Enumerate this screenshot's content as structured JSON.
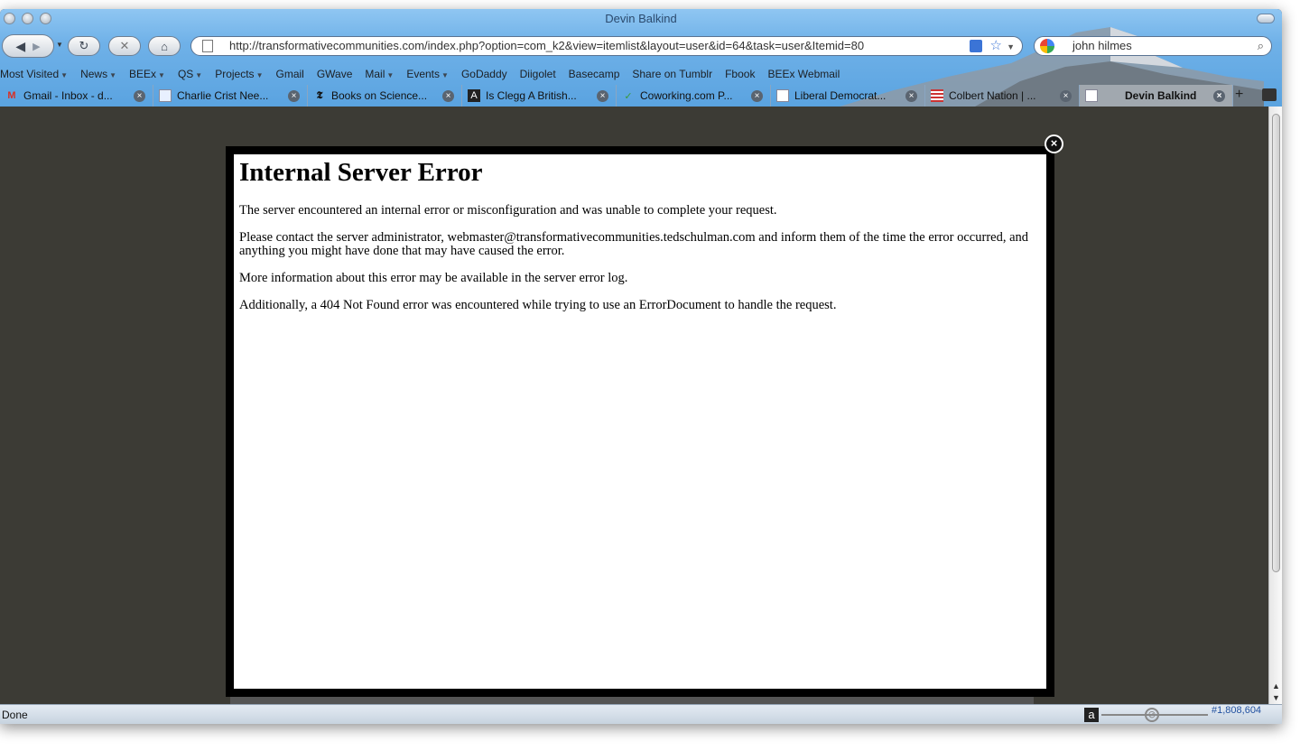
{
  "window": {
    "title": "Devin Balkind"
  },
  "nav": {
    "url": "http://transformativecommunities.com/index.php?option=com_k2&view=itemlist&layout=user&id=64&task=user&Itemid=80",
    "search_value": "john hilmes"
  },
  "bookmarks": [
    {
      "label": "Most Visited",
      "dropdown": true
    },
    {
      "label": "News",
      "dropdown": true
    },
    {
      "label": "BEEx",
      "dropdown": true
    },
    {
      "label": "QS",
      "dropdown": true
    },
    {
      "label": "Projects",
      "dropdown": true
    },
    {
      "label": "Gmail",
      "dropdown": false
    },
    {
      "label": "GWave",
      "dropdown": false
    },
    {
      "label": "Mail",
      "dropdown": true
    },
    {
      "label": "Events",
      "dropdown": true
    },
    {
      "label": "GoDaddy",
      "dropdown": false
    },
    {
      "label": "Diigolet",
      "dropdown": false
    },
    {
      "label": "Basecamp",
      "dropdown": false
    },
    {
      "label": "Share on Tumblr",
      "dropdown": false
    },
    {
      "label": "Fbook",
      "dropdown": false
    },
    {
      "label": "BEEx Webmail",
      "dropdown": false
    }
  ],
  "tabs": [
    {
      "label": "Gmail - Inbox - d...",
      "icon": "gmail-icon"
    },
    {
      "label": "Charlie Crist Nee...",
      "icon": "page-icon"
    },
    {
      "label": "Books on Science...",
      "icon": "nytimes-icon"
    },
    {
      "label": "Is Clegg A British...",
      "icon": "atlantic-icon"
    },
    {
      "label": "Coworking.com P...",
      "icon": "coworking-icon"
    },
    {
      "label": "Liberal Democrat...",
      "icon": "page-icon"
    },
    {
      "label": "Colbert Nation | ...",
      "icon": "flag-icon"
    },
    {
      "label": "Devin Balkind",
      "icon": "page-icon"
    }
  ],
  "error_page": {
    "heading": "Internal Server Error",
    "p1": "The server encountered an internal error or misconfiguration and was unable to complete your request.",
    "p2": "Please contact the server administrator, webmaster@transformativecommunities.tedschulman.com and inform them of the time the error occurred, and anything you might have done that may have caused the error.",
    "p3": "More information about this error may be available in the server error log.",
    "p4": "Additionally, a 404 Not Found error was encountered while trying to use an ErrorDocument to handle the request."
  },
  "status": {
    "text": "Done",
    "alexa_rank": "#1,808,604"
  }
}
